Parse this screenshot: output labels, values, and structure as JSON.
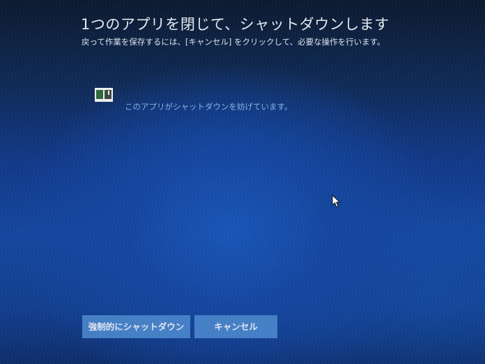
{
  "dialog": {
    "title": "1つのアプリを閉じて、シャットダウンします",
    "subtitle": "戻って作業を保存するには、[キャンセル] をクリックして、必要な操作を行います。"
  },
  "app_list": {
    "items": [
      {
        "icon": "app-window-icon",
        "message": "このアプリがシャットダウンを妨げています。"
      }
    ]
  },
  "buttons": {
    "force_shutdown_label": "強制的にシャットダウン",
    "cancel_label": "キャンセル"
  },
  "colors": {
    "background_dark": "#0c1a30",
    "background_blue": "#1447a0",
    "message_text": "#86b4ec",
    "button_fill": "#4a86cc"
  }
}
